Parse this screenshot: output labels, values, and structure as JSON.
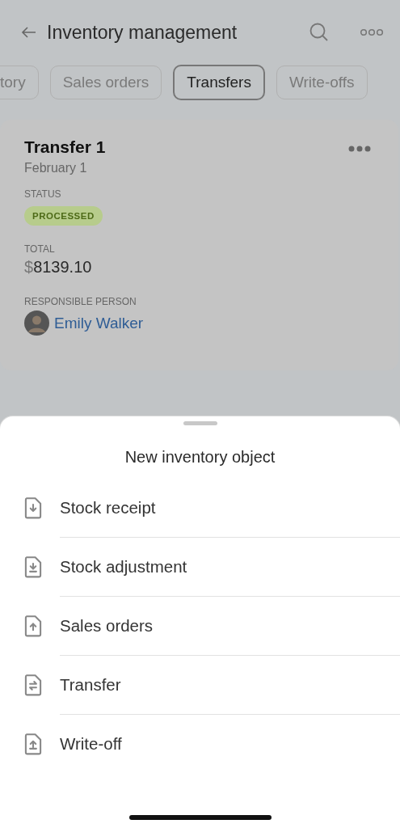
{
  "header": {
    "title": "Inventory management"
  },
  "tabs": [
    {
      "label": "tory",
      "selected": false
    },
    {
      "label": "Sales orders",
      "selected": false
    },
    {
      "label": "Transfers",
      "selected": true
    },
    {
      "label": "Write-offs",
      "selected": false
    }
  ],
  "card": {
    "title": "Transfer 1",
    "date": "February 1",
    "status_label": "STATUS",
    "status": "PROCESSED",
    "total_label": "TOTAL",
    "currency": "$",
    "amount": "8139.10",
    "person_label": "RESPONSIBLE PERSON",
    "person": "Emily Walker"
  },
  "sheet": {
    "title": "New inventory object",
    "items": [
      {
        "label": "Stock receipt",
        "kind": "down"
      },
      {
        "label": "Stock adjustment",
        "kind": "down-bar"
      },
      {
        "label": "Sales orders",
        "kind": "up"
      },
      {
        "label": "Transfer",
        "kind": "swap"
      },
      {
        "label": "Write-off",
        "kind": "up-bar"
      }
    ]
  }
}
